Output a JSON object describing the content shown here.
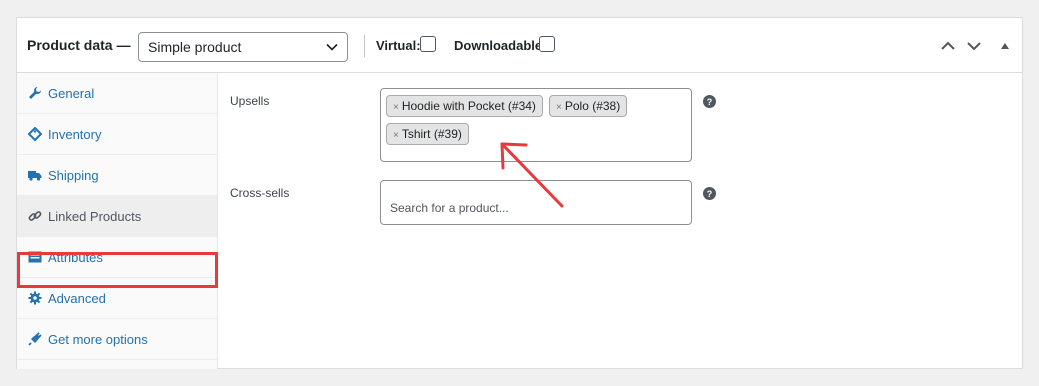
{
  "header": {
    "title": "Product data —",
    "product_type": "Simple product",
    "virtual_label": "Virtual:",
    "downloadable_label": "Downloadable:"
  },
  "tabs": [
    {
      "label": "General",
      "icon": "wrench-icon",
      "active": false
    },
    {
      "label": "Inventory",
      "icon": "tag-icon",
      "active": false
    },
    {
      "label": "Shipping",
      "icon": "truck-icon",
      "active": false
    },
    {
      "label": "Linked Products",
      "icon": "link-icon",
      "active": true
    },
    {
      "label": "Attributes",
      "icon": "list-icon",
      "active": false
    },
    {
      "label": "Advanced",
      "icon": "gear-icon",
      "active": false
    },
    {
      "label": "Get more options",
      "icon": "plugin-icon",
      "active": false
    }
  ],
  "upsells": {
    "label": "Upsells",
    "chips": [
      "Hoodie with Pocket (#34)",
      "Polo (#38)",
      "Tshirt (#39)"
    ]
  },
  "cross_sells": {
    "label": "Cross-sells",
    "placeholder": "Search for a product..."
  },
  "chip_remove_symbol": "×",
  "colors": {
    "link": "#2271b1",
    "highlight": "#e63a3d",
    "annotation_arrow": "#e63a3d"
  }
}
